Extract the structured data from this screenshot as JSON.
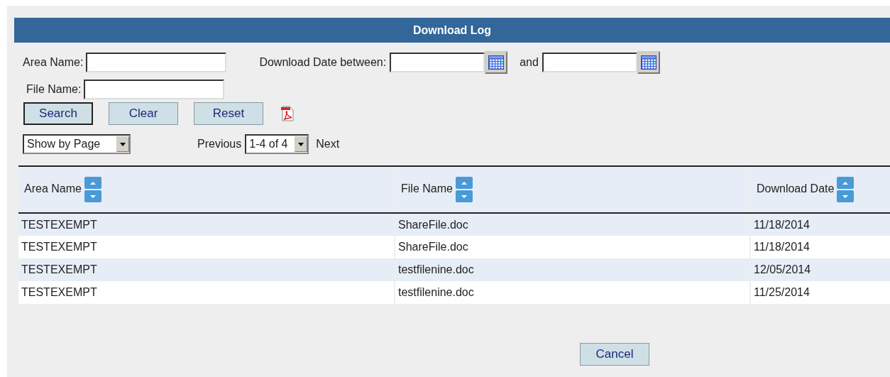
{
  "header": {
    "title": "Download Log"
  },
  "filters": [
    {
      "label": "Area Name:",
      "kind": "text"
    },
    {
      "label": "Download Date between:",
      "kind": "date"
    },
    {
      "label": "and",
      "kind": "date"
    },
    {
      "label": "File Name:",
      "kind": "text"
    }
  ],
  "buttons": [
    {
      "label": "Search",
      "focused": true
    },
    {
      "label": "Clear",
      "focused": false
    },
    {
      "label": "Reset",
      "focused": false
    }
  ],
  "view_select": {
    "value": "Show by Page"
  },
  "pager": {
    "previous": "Previous",
    "value": "1-4 of 4",
    "next": "Next"
  },
  "table": {
    "columns": [
      "Area Name",
      "File Name",
      "Download Date"
    ],
    "rows": [
      [
        "TESTEXEMPT",
        "ShareFile.doc",
        "11/18/2014"
      ],
      [
        "TESTEXEMPT",
        "ShareFile.doc",
        "11/18/2014"
      ],
      [
        "TESTEXEMPT",
        "testfilenine.doc",
        "12/05/2014"
      ],
      [
        "TESTEXEMPT",
        "testfilenine.doc",
        "11/25/2014"
      ]
    ]
  },
  "cancel_button": {
    "label": "Cancel"
  }
}
